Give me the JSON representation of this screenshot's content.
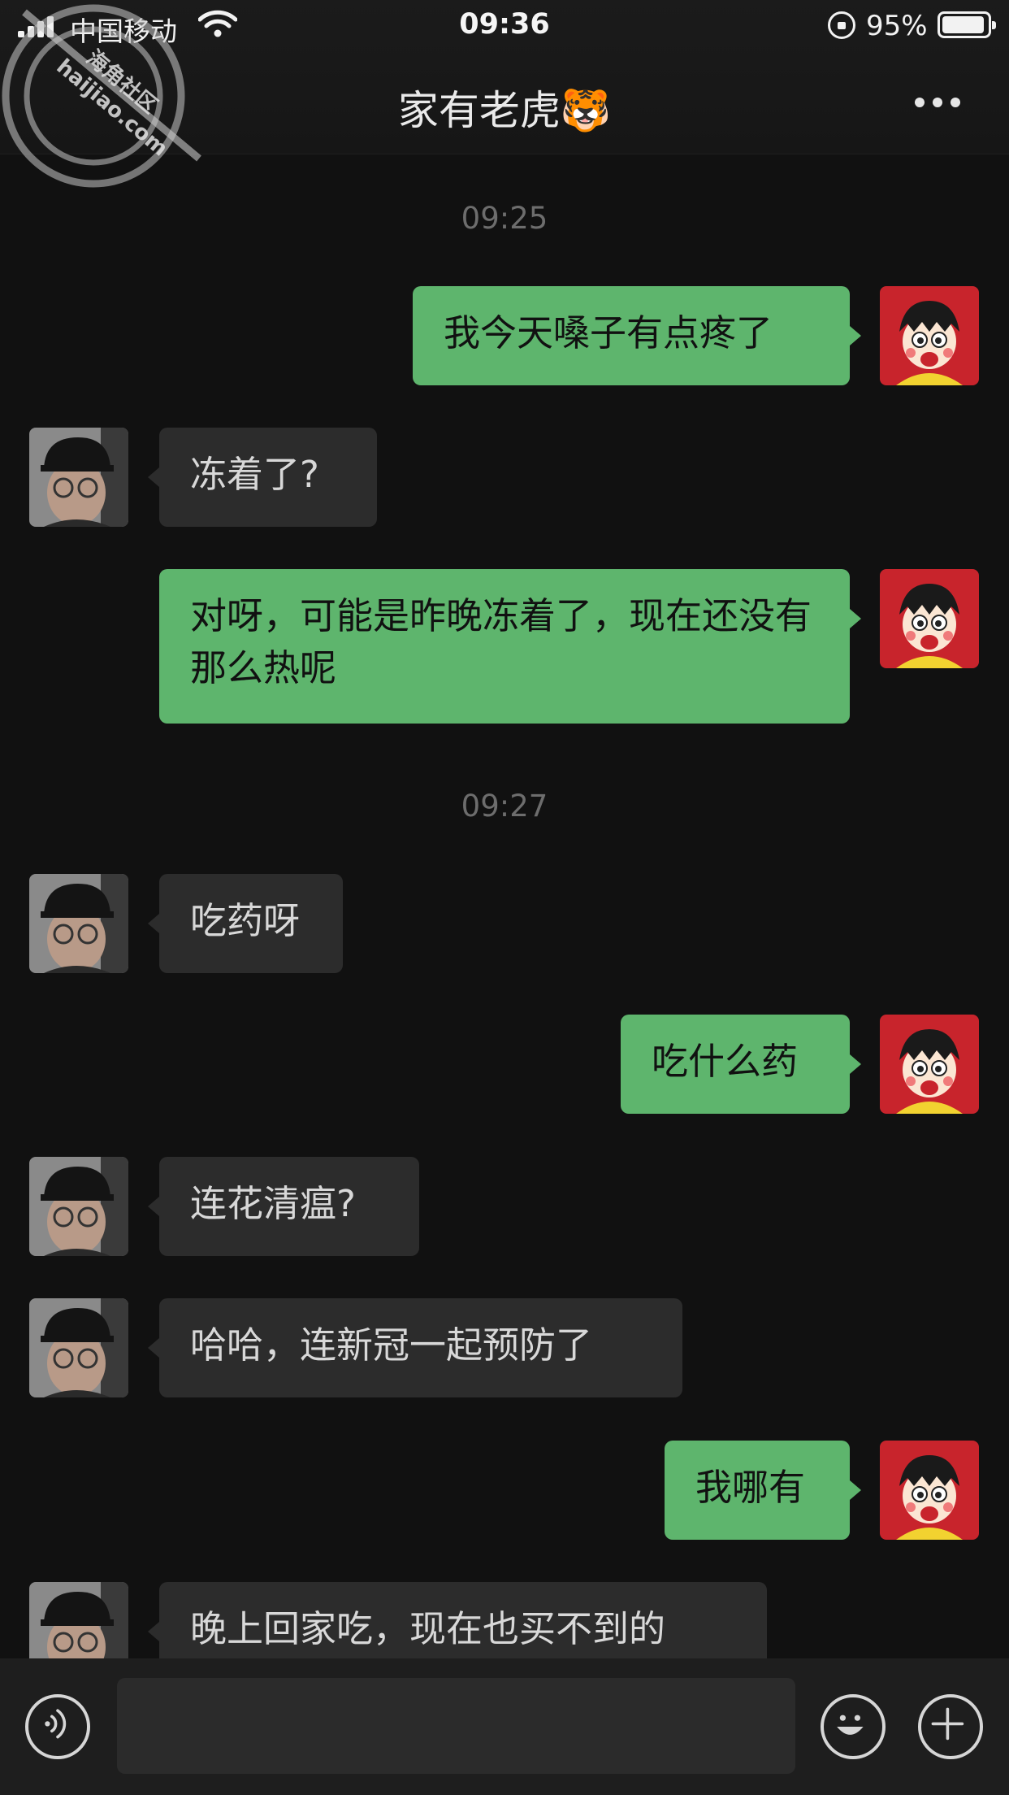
{
  "status": {
    "carrier": "中国移动",
    "time": "09:36",
    "battery_pct": "95%",
    "battery_level": 0.95
  },
  "header": {
    "title": "家有老虎🐯"
  },
  "watermark": {
    "line1": "海角社区",
    "line2": "haijiao.com"
  },
  "messages": [
    {
      "type": "time",
      "text": "09:25"
    },
    {
      "type": "me",
      "text": "我今天嗓子有点疼了"
    },
    {
      "type": "them",
      "text": "冻着了?"
    },
    {
      "type": "me",
      "text": "对呀，可能是昨晚冻着了，现在还没有那么热呢"
    },
    {
      "type": "time",
      "text": "09:27"
    },
    {
      "type": "them",
      "text": "吃药呀"
    },
    {
      "type": "me",
      "text": "吃什么药"
    },
    {
      "type": "them",
      "text": "连花清瘟?"
    },
    {
      "type": "them",
      "text": "哈哈，连新冠一起预防了"
    },
    {
      "type": "me",
      "text": "我哪有"
    },
    {
      "type": "them",
      "text": "晚上回家吃，现在也买不到的"
    }
  ],
  "icons": {
    "voice": "voice-icon",
    "emoji": "emoji-icon",
    "plus": "plus-icon",
    "more": "more-icon"
  },
  "colors": {
    "my_bubble": "#5eb56d",
    "their_bubble": "#2c2c2c",
    "background": "#111111"
  }
}
